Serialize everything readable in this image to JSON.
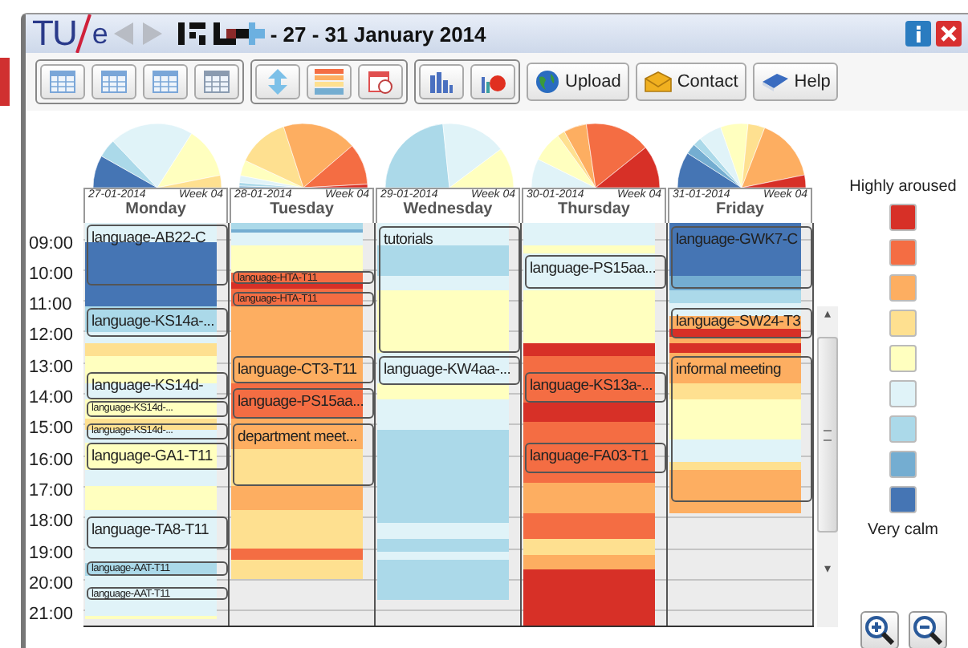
{
  "logo": {
    "left": "TU",
    "right": "e"
  },
  "title": "- 27 - 31 January 2014",
  "toolbar": {
    "groups": [
      {
        "items": [
          {
            "kind": "week-grid"
          },
          {
            "kind": "month-grid"
          },
          {
            "kind": "list-grid"
          },
          {
            "kind": "tools-grid"
          }
        ]
      },
      {
        "items": [
          {
            "kind": "arrows"
          },
          {
            "kind": "color-bars"
          },
          {
            "kind": "calendar-clock"
          }
        ]
      },
      {
        "items": [
          {
            "kind": "bar-chart"
          },
          {
            "kind": "pie-chart"
          }
        ]
      }
    ],
    "buttons": [
      {
        "kind": "globe",
        "label": "Upload"
      },
      {
        "kind": "envelope",
        "label": "Contact"
      },
      {
        "kind": "book",
        "label": "Help"
      }
    ]
  },
  "hours": [
    "09:00",
    "10:00",
    "11:00",
    "12:00",
    "13:00",
    "14:00",
    "15:00",
    "16:00",
    "17:00",
    "18:00",
    "19:00",
    "20:00",
    "21:00"
  ],
  "days": [
    {
      "date": "27-01-2014",
      "week": "Week 04",
      "name": "Monday",
      "events": [
        {
          "label": "language-AB22-C",
          "kind": "normal"
        },
        {
          "label": "language-KS14a-...",
          "kind": "normal"
        },
        {
          "label": "language-KS14d-",
          "kind": "normal"
        },
        {
          "label": "language-KS14d-...",
          "kind": "small"
        },
        {
          "label": "language-KS14d-...",
          "kind": "small"
        },
        {
          "label": "language-GA1-T11",
          "kind": "normal"
        },
        {
          "label": "language-TA8-T11",
          "kind": "normal"
        },
        {
          "label": "language-AAT-T11",
          "kind": "small"
        },
        {
          "label": "language-AAT-T11",
          "kind": "small"
        }
      ]
    },
    {
      "date": "28-01-2014",
      "week": "Week 04",
      "name": "Tuesday",
      "events": [
        {
          "label": "language-HTA-T11",
          "kind": "small"
        },
        {
          "label": "language-HTA-T11",
          "kind": "small"
        },
        {
          "label": "language-CT3-T11",
          "kind": "normal"
        },
        {
          "label": "language-PS15aa...",
          "kind": "normal"
        },
        {
          "label": "department meet...",
          "kind": "normal"
        }
      ]
    },
    {
      "date": "29-01-2014",
      "week": "Week 04",
      "name": "Wednesday",
      "events": [
        {
          "label": "tutorials",
          "kind": "normal"
        },
        {
          "label": "language-KW4aa-...",
          "kind": "normal"
        }
      ]
    },
    {
      "date": "30-01-2014",
      "week": "Week 04",
      "name": "Thursday",
      "events": [
        {
          "label": "language-PS15aa...",
          "kind": "normal"
        },
        {
          "label": "language-KS13a-...",
          "kind": "normal"
        },
        {
          "label": "language-FA03-T1",
          "kind": "normal"
        }
      ]
    },
    {
      "date": "31-01-2014",
      "week": "Week 04",
      "name": "Friday",
      "events": [
        {
          "label": "language-GWK7-C",
          "kind": "normal"
        },
        {
          "label": "language-SW24-T3",
          "kind": "normal"
        },
        {
          "label": "informal meeting",
          "kind": "normal"
        }
      ]
    }
  ],
  "scrollbar": {
    "up": "▴",
    "down": "▾"
  },
  "legend": {
    "top": "Highly aroused",
    "bottom": "Very calm",
    "swatches": [
      {
        "color": "#d73027"
      },
      {
        "color": "#f46d43"
      },
      {
        "color": "#fdae61"
      },
      {
        "color": "#fee090"
      },
      {
        "color": "#ffffbf"
      },
      {
        "color": "#e0f3f8"
      },
      {
        "color": "#abd9e9"
      },
      {
        "color": "#74add1"
      },
      {
        "color": "#4575b4"
      }
    ]
  }
}
